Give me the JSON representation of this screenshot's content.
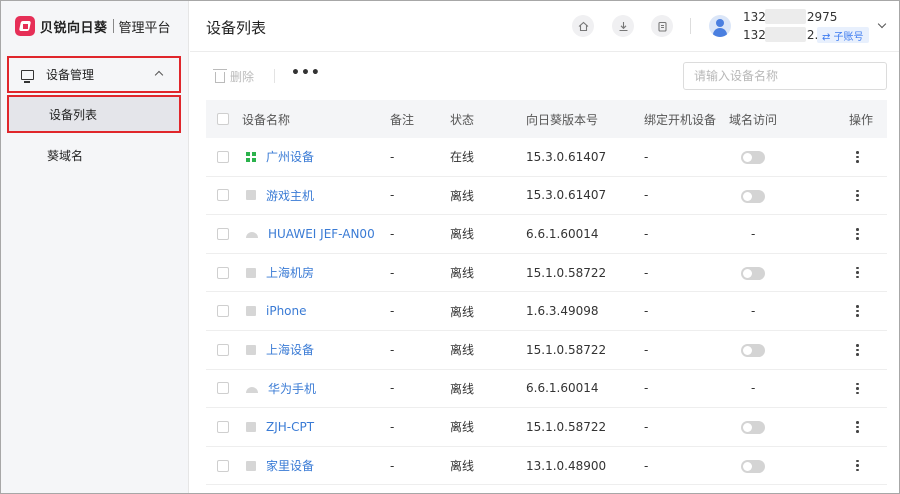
{
  "brand": {
    "name": "贝锐向日葵",
    "subtitle": "管理平台",
    "color": "#e62f57"
  },
  "sidebar": {
    "group": {
      "label": "设备管理",
      "expanded": true
    },
    "items": [
      {
        "label": "设备列表",
        "active": true
      },
      {
        "label": "葵域名",
        "active": false
      }
    ]
  },
  "header": {
    "title": "设备列表",
    "icons": [
      "home-icon",
      "download-icon",
      "clipboard-icon"
    ],
    "account": {
      "line1_prefix": "132",
      "line1_suffix": "2975",
      "line2_prefix": "132",
      "line2_suffix": "2...",
      "badge": "⇄ 子账号"
    }
  },
  "toolbar": {
    "delete_label": "删除",
    "more_label": "•••",
    "search_placeholder": "请输入设备名称"
  },
  "table": {
    "columns": [
      "设备名称",
      "备注",
      "状态",
      "向日葵版本号",
      "绑定开机设备",
      "域名访问",
      "操作"
    ],
    "rows": [
      {
        "icon": "windows",
        "name": "广州设备",
        "remark": "-",
        "status": "在线",
        "version": "15.3.0.61407",
        "bind": "-",
        "domain": "toggle"
      },
      {
        "icon": "grey",
        "name": "游戏主机",
        "remark": "-",
        "status": "离线",
        "version": "15.3.0.61407",
        "bind": "-",
        "domain": "toggle"
      },
      {
        "icon": "android",
        "name": "HUAWEI JEF-AN00",
        "remark": "-",
        "status": "离线",
        "version": "6.6.1.60014",
        "bind": "-",
        "domain": "-"
      },
      {
        "icon": "grey",
        "name": "上海机房",
        "remark": "-",
        "status": "离线",
        "version": "15.1.0.58722",
        "bind": "-",
        "domain": "toggle"
      },
      {
        "icon": "grey",
        "name": "iPhone",
        "remark": "-",
        "status": "离线",
        "version": "1.6.3.49098",
        "bind": "-",
        "domain": "-"
      },
      {
        "icon": "grey",
        "name": "上海设备",
        "remark": "-",
        "status": "离线",
        "version": "15.1.0.58722",
        "bind": "-",
        "domain": "toggle"
      },
      {
        "icon": "android",
        "name": "华为手机",
        "remark": "-",
        "status": "离线",
        "version": "6.6.1.60014",
        "bind": "-",
        "domain": "-"
      },
      {
        "icon": "grey",
        "name": "ZJH-CPT",
        "remark": "-",
        "status": "离线",
        "version": "15.1.0.58722",
        "bind": "-",
        "domain": "toggle"
      },
      {
        "icon": "grey",
        "name": "家里设备",
        "remark": "-",
        "status": "离线",
        "version": "13.1.0.48900",
        "bind": "-",
        "domain": "toggle"
      }
    ]
  },
  "colors": {
    "link": "#3a7bd5",
    "highlight": "#e0262b",
    "badge": "#3d7bf0"
  }
}
